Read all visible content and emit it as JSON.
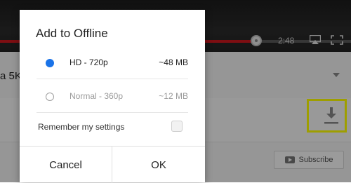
{
  "player": {
    "time": "2:48",
    "progress_percent": 73
  },
  "video": {
    "title_fragment": "a 5K"
  },
  "subscribe": {
    "label": "Subscribe"
  },
  "dialog": {
    "title": "Add to Offline",
    "options": [
      {
        "label": "HD - 720p",
        "size": "~48 MB",
        "selected": true
      },
      {
        "label": "Normal - 360p",
        "size": "~12 MB",
        "selected": false
      }
    ],
    "remember_label": "Remember my settings",
    "remember_checked": false,
    "cancel_label": "Cancel",
    "ok_label": "OK"
  },
  "colors": {
    "accent": "#1a73e8",
    "progress": "#cc181e",
    "highlight": "#ffff00"
  },
  "icons": [
    "scrubber-icon",
    "airplay-icon",
    "fullscreen-icon",
    "chevron-down-icon",
    "download-icon",
    "youtube-icon"
  ]
}
